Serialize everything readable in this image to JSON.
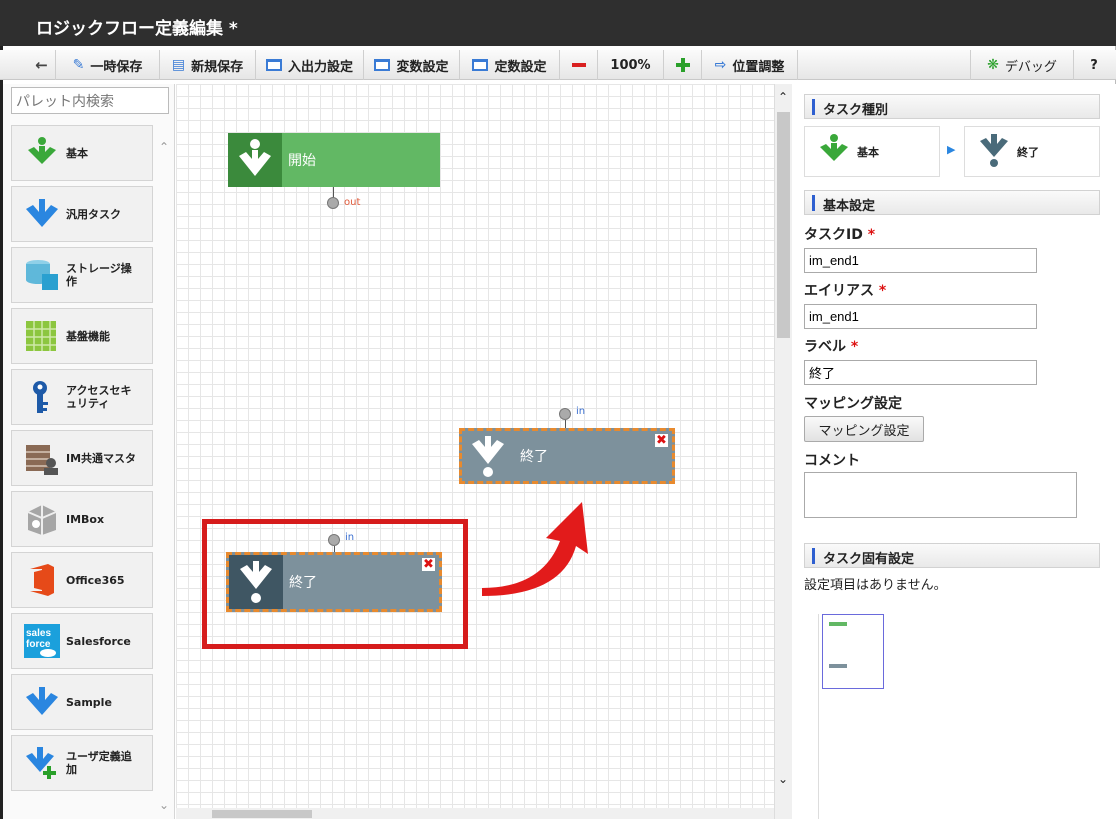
{
  "window": {
    "title": "ロジックフロー定義編集 *"
  },
  "toolbar": {
    "temp_save": "一時保存",
    "new_save": "新規保存",
    "io_settings": "入出力設定",
    "var_settings": "変数設定",
    "const_settings": "定数設定",
    "zoom": "100%",
    "position_adjust": "位置調整",
    "debug": "デバッグ",
    "help": "?"
  },
  "palette": {
    "search_placeholder": "パレット内検索",
    "items": [
      {
        "label": "基本",
        "icon": "green-down-arrow-icon"
      },
      {
        "label": "汎用タスク",
        "icon": "blue-down-arrow-icon"
      },
      {
        "label": "ストレージ操作",
        "icon": "storage-icon"
      },
      {
        "label": "基盤機能",
        "icon": "grid-icon"
      },
      {
        "label": "アクセスセキュリティ",
        "icon": "key-icon"
      },
      {
        "label": "IM共通マスタ",
        "icon": "master-icon"
      },
      {
        "label": "IMBox",
        "icon": "box-icon"
      },
      {
        "label": "Office365",
        "icon": "office-icon"
      },
      {
        "label": "Salesforce",
        "icon": "salesforce-icon"
      },
      {
        "label": "Sample",
        "icon": "blue-down-arrow-icon"
      },
      {
        "label": "ユーザ定義追加",
        "icon": "user-defined-add-icon"
      }
    ]
  },
  "canvas": {
    "start_node": {
      "label": "開始",
      "port": "out"
    },
    "end_node_moved": {
      "label": "終了",
      "port": "in"
    },
    "end_node_original": {
      "label": "終了",
      "port": "in"
    }
  },
  "panel": {
    "task_type_header": "タスク種別",
    "task_type_category": "基本",
    "task_type_name": "終了",
    "basic_header": "基本設定",
    "task_id_label": "タスクID",
    "task_id_value": "im_end1",
    "alias_label": "エイリアス",
    "alias_value": "im_end1",
    "label_label": "ラベル",
    "label_value": "終了",
    "mapping_label": "マッピング設定",
    "mapping_button": "マッピング設定",
    "comment_label": "コメント",
    "specific_header": "タスク固有設定",
    "no_items": "設定項目はありません。"
  },
  "colors": {
    "start_green": "#62b864",
    "end_gray": "#7d919c",
    "selected_border": "#e88a2e",
    "highlight_red": "#d61c1c"
  }
}
